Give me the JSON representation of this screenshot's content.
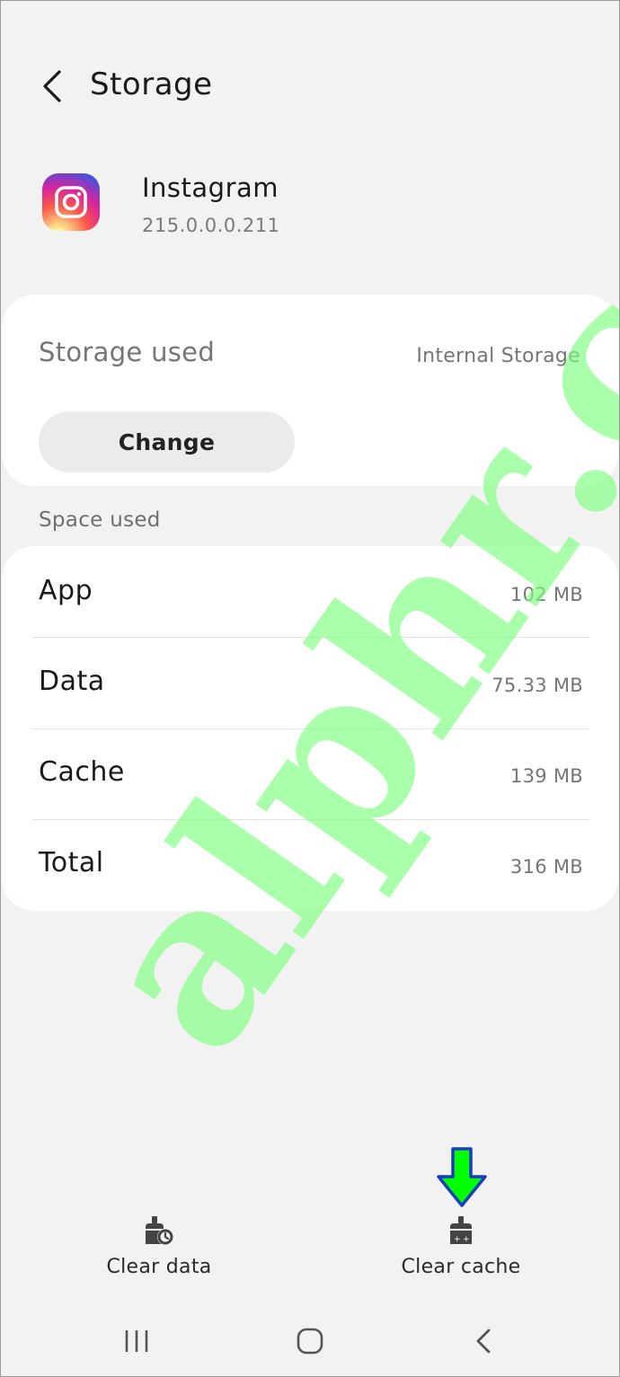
{
  "header": {
    "title": "Storage",
    "back_icon": "chevron-left-icon"
  },
  "app": {
    "name": "Instagram",
    "version": "215.0.0.0.211",
    "icon": "instagram-logo"
  },
  "storage_card": {
    "label": "Storage used",
    "location": "Internal Storage",
    "change_label": "Change"
  },
  "space_used": {
    "section_label": "Space used",
    "rows": [
      {
        "label": "App",
        "value": "102 MB"
      },
      {
        "label": "Data",
        "value": "75.33 MB"
      },
      {
        "label": "Cache",
        "value": "139 MB"
      },
      {
        "label": "Total",
        "value": "316 MB"
      }
    ]
  },
  "actions": {
    "clear_data": {
      "label": "Clear data",
      "icon": "clear-data-icon"
    },
    "clear_cache": {
      "label": "Clear cache",
      "icon": "clear-cache-icon"
    }
  },
  "annotation": {
    "arrow_color": "#00ff00",
    "arrow_outline": "#1a3dbf",
    "icon": "down-arrow-icon"
  },
  "watermark": {
    "text": "alphr.com",
    "color": "#7dff7d"
  },
  "nav": {
    "recent": "recent-apps-icon",
    "home": "home-icon",
    "back": "back-icon"
  }
}
